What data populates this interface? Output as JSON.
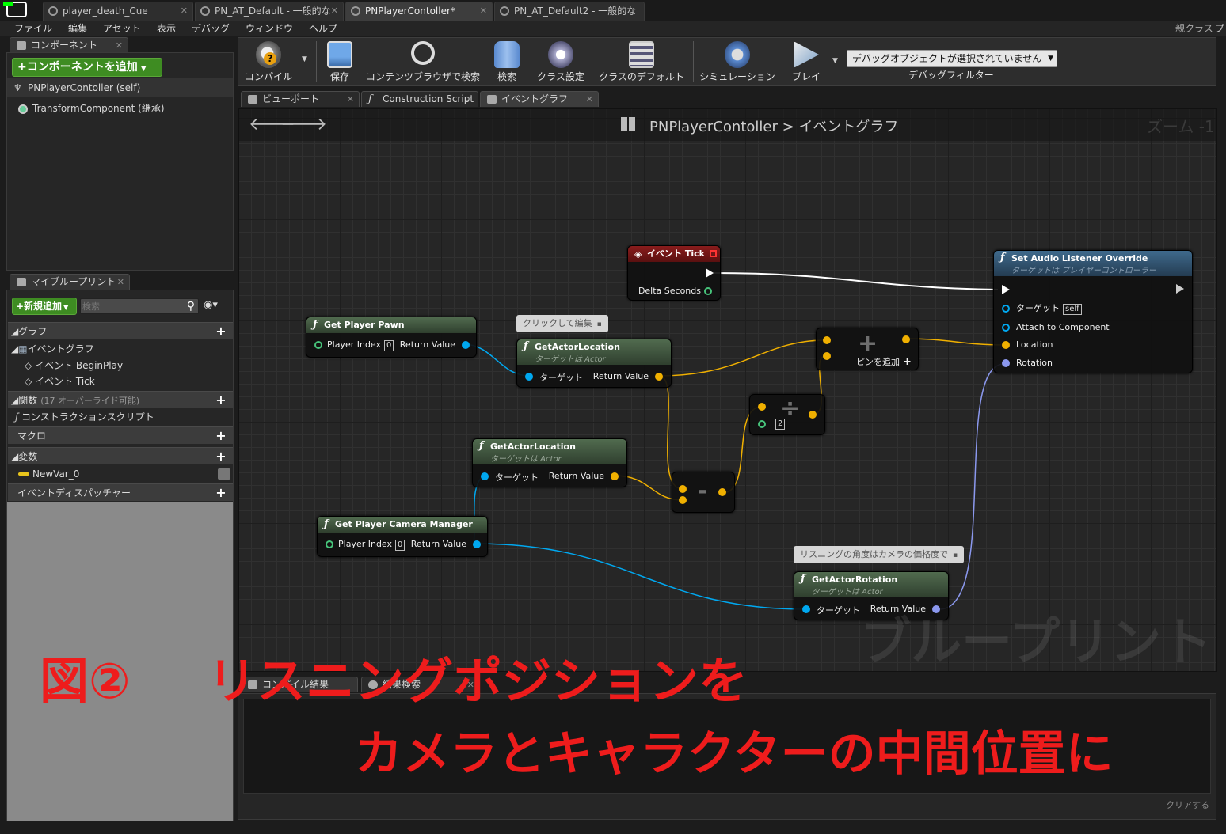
{
  "tabs": [
    {
      "label": "player_death_Cue"
    },
    {
      "label": "PN_AT_Default - 一般的な"
    },
    {
      "label": "PNPlayerContoller*"
    },
    {
      "label": "PN_AT_Default2 - 一般的な"
    }
  ],
  "parent_class_label": "親クラス",
  "parent_class_value": "プ",
  "menu": [
    "ファイル",
    "編集",
    "アセット",
    "表示",
    "デバッグ",
    "ウィンドウ",
    "ヘルプ"
  ],
  "components": {
    "tab": "コンポーネント",
    "add_button": "+コンポーネントを追加",
    "self_item": "PNPlayerContoller (self)",
    "transform_item": "TransformComponent (継承)"
  },
  "my_blueprint": {
    "tab": "マイブループリント",
    "add_new": "+新規追加",
    "search_placeholder": "検索",
    "graphs_header": "グラフ",
    "event_graph": "イベントグラフ",
    "begin_play": "イベント BeginPlay",
    "tick": "イベント Tick",
    "functions_header": "関数",
    "functions_note": "(17 オーバーライド可能)",
    "construction_script": "コンストラクションスクリプト",
    "macros_header": "マクロ",
    "variables_header": "変数",
    "var0": "NewVar_0",
    "dispatchers_header": "イベントディスパッチャー"
  },
  "toolbar": {
    "compile": "コンパイル",
    "save": "保存",
    "browse": "コンテンツブラウザで検索",
    "search": "検索",
    "class_settings": "クラス設定",
    "class_defaults": "クラスのデフォルト",
    "simulation": "シミュレーション",
    "play": "プレイ",
    "debug_object": "デバッグオブジェクトが選択されていません",
    "debug_filter": "デバッグフィルター"
  },
  "editor_tabs": [
    "ビューポート",
    "Construction Script",
    "イベントグラフ"
  ],
  "graph": {
    "breadcrumb_root": "PNPlayerContoller",
    "breadcrumb_sep": ">",
    "breadcrumb_leaf": "イベントグラフ",
    "zoom": "ズーム -1",
    "watermark": "ブループリント",
    "nodes": {
      "event_tick": {
        "title": "イベント Tick",
        "pin": "Delta Seconds"
      },
      "get_player_pawn": {
        "title": "Get Player Pawn",
        "in": "Player Index",
        "in_val": "0",
        "out": "Return Value"
      },
      "get_actor_location_1": {
        "title": "GetActorLocation",
        "sub": "ターゲットは Actor",
        "in": "ターゲット",
        "out": "Return Value"
      },
      "get_actor_location_2": {
        "title": "GetActorLocation",
        "sub": "ターゲットは Actor",
        "in": "ターゲット",
        "out": "Return Value"
      },
      "get_camera_manager": {
        "title": "Get Player Camera Manager",
        "in": "Player Index",
        "in_val": "0",
        "out": "Return Value"
      },
      "get_actor_rotation": {
        "title": "GetActorRotation",
        "sub": "ターゲットは Actor",
        "in": "ターゲット",
        "out": "Return Value"
      },
      "add": {
        "add_pin": "ピンを追加"
      },
      "divide": {
        "in_val": "2"
      },
      "set_audio_listener": {
        "title": "Set Audio Listener Override",
        "sub": "ターゲットは プレイヤーコントローラー",
        "target": "ターゲット",
        "target_val": "self",
        "attach": "Attach to Component",
        "location": "Location",
        "rotation": "Rotation"
      }
    },
    "comments": {
      "edit_hint": "クリックして編集",
      "rotation_note": "リスニングの角度はカメラの価格度で"
    }
  },
  "bottom_tabs": [
    "コンパイル結果",
    "結果検索"
  ],
  "clear_button": "クリアする",
  "annotation": {
    "line1_prefix": "図②",
    "line1": "リスニングポジションを",
    "line2": "カメラとキャラクターの中間位置に"
  }
}
